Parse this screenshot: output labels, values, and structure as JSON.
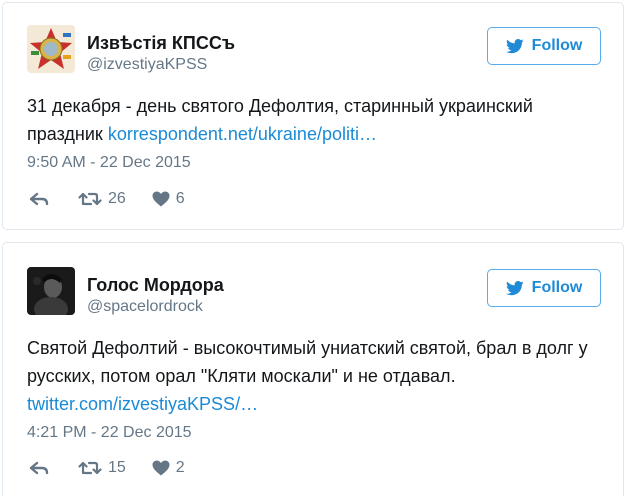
{
  "tweets": [
    {
      "name": "Извѣстія КПССъ",
      "handle": "@izvestiyaKPSS",
      "follow_label": "Follow",
      "text": "31 декабря - день святого Дефолтия, старинный украинский праздник ",
      "link": "korrespondent.net/ukraine/politi…",
      "timestamp": "9:50 AM - 22 Dec 2015",
      "retweets": "26",
      "likes": "6"
    },
    {
      "name": "Голос Мордора",
      "handle": "@spacelordrock",
      "follow_label": "Follow",
      "text": "Святой Дефолтий - высокочтимый униатский святой, брал в долг у русских, потом орал \"Кляти москали\" и не отдавал. ",
      "link": "twitter.com/izvestiyaKPSS/…",
      "timestamp": "4:21 PM - 22 Dec 2015",
      "retweets": "15",
      "likes": "2"
    }
  ],
  "colors": {
    "link": "#1b8ad6",
    "muted": "#657786",
    "follow_border": "#55acee",
    "card_border": "#e1e8ed"
  },
  "icons": [
    "bird-icon",
    "reply-icon",
    "retweet-icon",
    "heart-icon"
  ]
}
